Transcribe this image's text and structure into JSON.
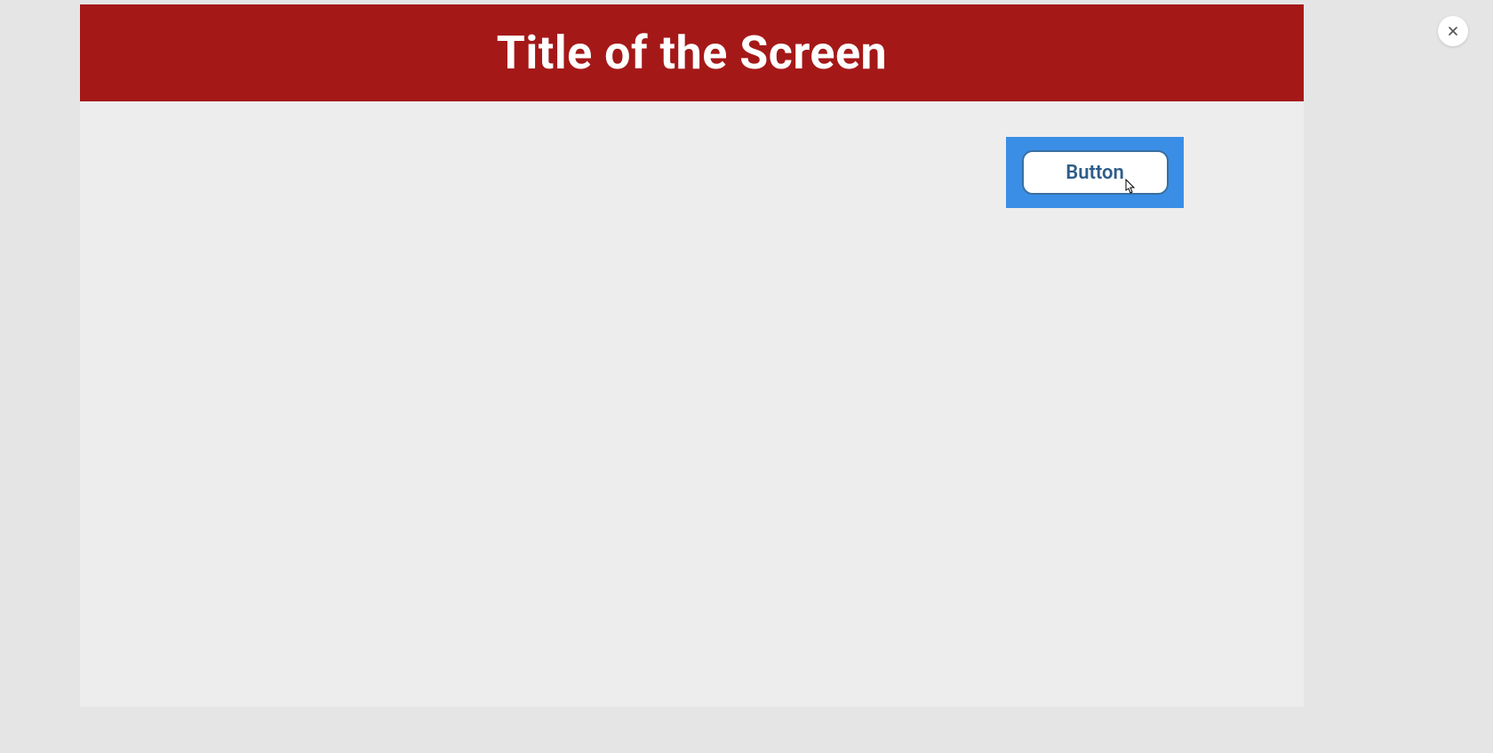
{
  "header": {
    "title": "Title of the Screen"
  },
  "main": {
    "button_label": "Button"
  },
  "colors": {
    "header_bg": "#a51818",
    "highlight": "#3a8ee6",
    "button_text": "#2f5d8a"
  }
}
